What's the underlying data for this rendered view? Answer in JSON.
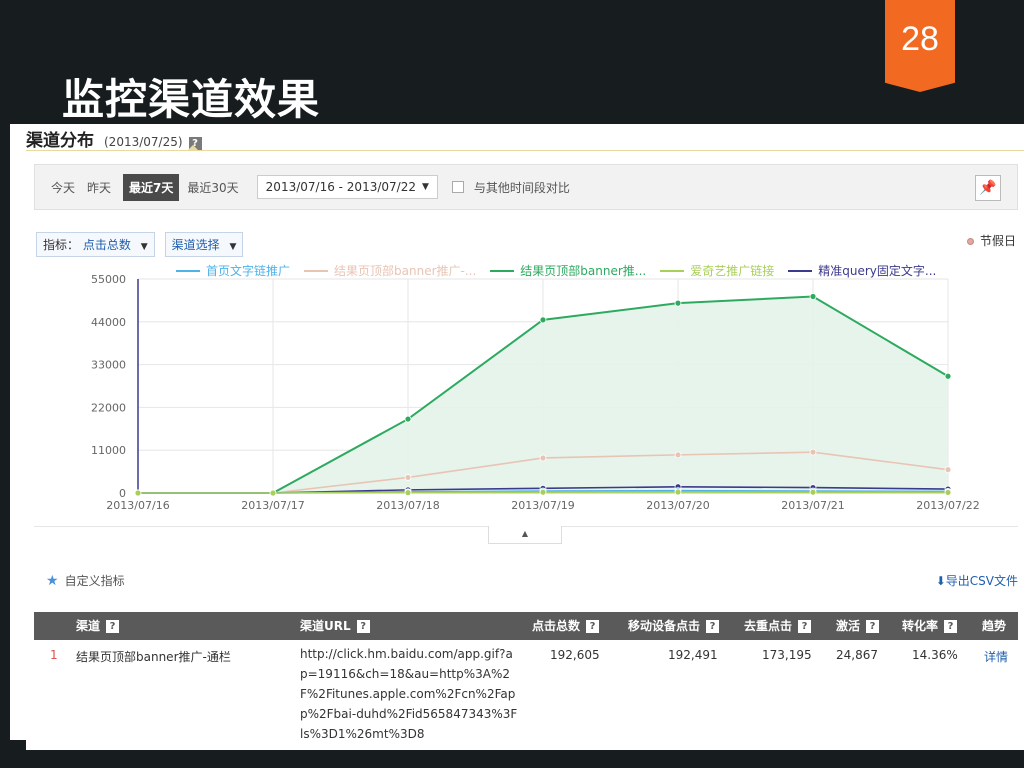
{
  "slide": {
    "title": "监控渠道效果",
    "page_number": "28"
  },
  "section": {
    "title": "渠道分布",
    "date": "(2013/07/25)"
  },
  "filters": {
    "periods": [
      "今天",
      "昨天",
      "最近7天",
      "最近30天"
    ],
    "active_period": "最近7天",
    "date_range": "2013/07/16 - 2013/07/22",
    "compare_label": "与其他时间段对比"
  },
  "selectors": {
    "metric_label": "指标：",
    "metric_value": "点击总数",
    "channel_label": "渠道选择"
  },
  "holiday_label": "节假日",
  "legend": [
    {
      "name": "首页文字链推广",
      "color": "#4fb3e8"
    },
    {
      "name": "结果页顶部banner推广-...",
      "color": "#e8c4b4"
    },
    {
      "name": "结果页顶部banner推...",
      "color": "#2daa5f"
    },
    {
      "name": "爱奇艺推广链接",
      "color": "#a8cf5a"
    },
    {
      "name": "精准query固定文字...",
      "color": "#3c3a8c"
    }
  ],
  "chart_data": {
    "type": "area",
    "x": [
      "2013/07/16",
      "2013/07/17",
      "2013/07/18",
      "2013/07/19",
      "2013/07/20",
      "2013/07/21",
      "2013/07/22"
    ],
    "y_ticks": [
      "55000",
      "44000",
      "33000",
      "22000",
      "11000",
      "0"
    ],
    "ylim": [
      0,
      55000
    ],
    "series": [
      {
        "name": "结果页顶部banner推...",
        "color": "#2daa5f",
        "fill": "#e4f3ea",
        "values": [
          0,
          0,
          19000,
          44500,
          48800,
          50500,
          30000
        ]
      },
      {
        "name": "结果页顶部banner推广-...",
        "color": "#e8c4b4",
        "values": [
          0,
          0,
          4000,
          9000,
          9800,
          10500,
          6000
        ]
      },
      {
        "name": "精准query固定文字...",
        "color": "#3c3a8c",
        "values": [
          0,
          0,
          800,
          1200,
          1600,
          1400,
          1000
        ]
      },
      {
        "name": "首页文字链推广",
        "color": "#4fb3e8",
        "values": [
          0,
          0,
          300,
          500,
          600,
          500,
          400
        ]
      },
      {
        "name": "爱奇艺推广链接",
        "color": "#a8cf5a",
        "values": [
          0,
          0,
          100,
          200,
          250,
          200,
          150
        ]
      }
    ]
  },
  "custom_metric_label": "自定义指标",
  "export_label": "导出CSV文件",
  "table": {
    "headers": {
      "channel": "渠道",
      "url": "渠道URL",
      "clicks": "点击总数",
      "mobile": "移动设备点击",
      "unique": "去重点击",
      "activation": "激活",
      "conversion": "转化率",
      "trend": "趋势"
    },
    "rows": [
      {
        "index": "1",
        "channel": "结果页顶部banner推广-通栏",
        "url": "http://click.hm.baidu.com/app.gif?ap=19116&ch=18&au=http%3A%2F%2Fitunes.apple.com%2Fcn%2Fapp%2Fbai-duhd%2Fid565847343%3Fls%3D1%26mt%3D8",
        "clicks": "192,605",
        "mobile": "192,491",
        "unique": "173,195",
        "activation": "24,867",
        "conversion": "14.36%",
        "trend": "详情"
      }
    ]
  }
}
